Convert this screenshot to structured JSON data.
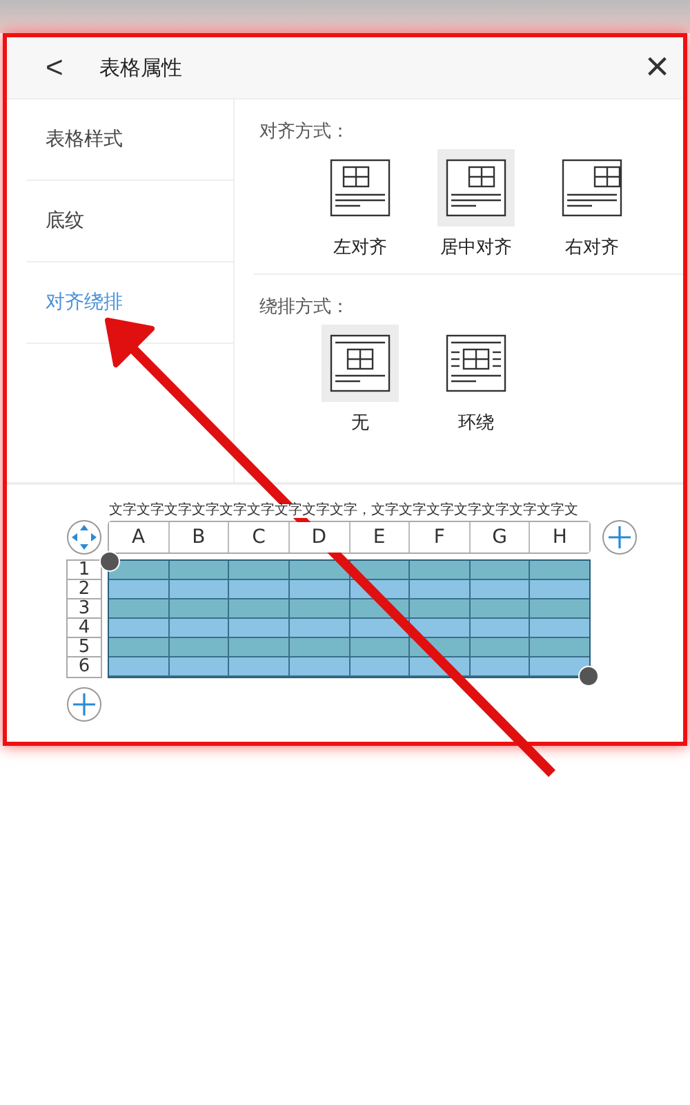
{
  "header": {
    "back": "<",
    "title": "表格属性",
    "close": "×"
  },
  "sidebar": {
    "items": [
      {
        "label": "表格样式",
        "selected": false
      },
      {
        "label": "底纹",
        "selected": false
      },
      {
        "label": "对齐绕排",
        "selected": true
      }
    ]
  },
  "sections": [
    {
      "title": "对齐方式：",
      "options": [
        {
          "label": "左对齐",
          "kind": "left",
          "selected": false
        },
        {
          "label": "居中对齐",
          "kind": "center",
          "selected": true
        },
        {
          "label": "右对齐",
          "kind": "right",
          "selected": false
        }
      ]
    },
    {
      "title": "绕排方式：",
      "options": [
        {
          "label": "无",
          "kind": "none",
          "selected": true
        },
        {
          "label": "环绕",
          "kind": "around",
          "selected": false
        }
      ]
    }
  ],
  "preview": {
    "caption": "文字文字文字文字文字文字文字文字文字，文字文字文字文字文字文字文字文",
    "columns": [
      "A",
      "B",
      "C",
      "D",
      "E",
      "F",
      "G",
      "H"
    ],
    "rows": [
      "1",
      "2",
      "3",
      "4",
      "5",
      "6"
    ]
  }
}
